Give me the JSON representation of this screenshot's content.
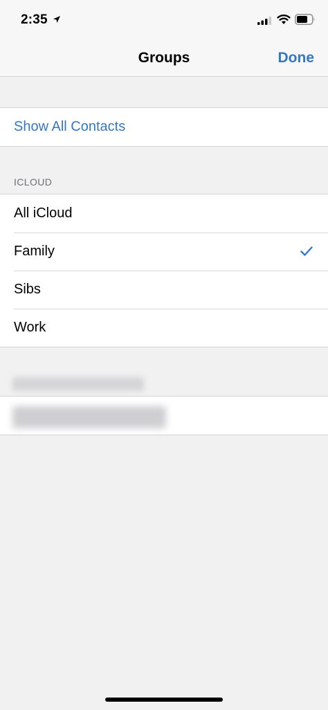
{
  "status_bar": {
    "time": "2:35",
    "icons": [
      "location-icon",
      "signal-icon",
      "wifi-icon",
      "battery-icon"
    ]
  },
  "nav": {
    "title": "Groups",
    "done_label": "Done"
  },
  "show_all": {
    "label": "Show All Contacts"
  },
  "icloud_section": {
    "header": "ICLOUD",
    "items": [
      {
        "label": "All iCloud",
        "selected": false
      },
      {
        "label": "Family",
        "selected": true
      },
      {
        "label": "Sibs",
        "selected": false
      },
      {
        "label": "Work",
        "selected": false
      }
    ]
  },
  "colors": {
    "accent": "#3478c5",
    "background": "#f1f1f2",
    "separator": "#d1d1d6",
    "section_header": "#6d6d72"
  }
}
